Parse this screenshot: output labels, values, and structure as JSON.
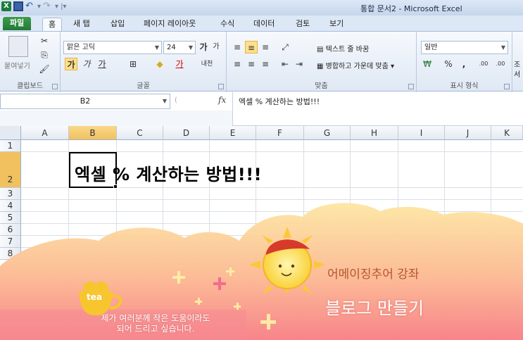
{
  "window": {
    "title": "통합 문서2  -  Microsoft Excel"
  },
  "quick_access": {
    "app_icon": "X",
    "save_icon": "save-icon",
    "undo_icon": "undo-icon",
    "redo_icon": "redo-icon"
  },
  "tabs": [
    "파일",
    "홈",
    "새 탭",
    "삽입",
    "페이지 레이아웃",
    "수식",
    "데이터",
    "검토",
    "보기"
  ],
  "ribbon": {
    "clipboard": {
      "paste_label": "붙여넣기",
      "group_label": "클립보드"
    },
    "font": {
      "font_name": "맑은 고딕",
      "font_size": "24",
      "grow": "가",
      "shrink": "가",
      "bold": "가",
      "italic": "가",
      "underline": "가",
      "font_color": "가",
      "phonetic": "내천",
      "group_label": "글꼴"
    },
    "alignment": {
      "wrap_text": "텍스트 줄 바꿈",
      "merge_center": "병합하고 가운데 맞춤",
      "group_label": "맞춤"
    },
    "number": {
      "format": "일반",
      "percent": "%",
      "comma": ",",
      "inc_decimal": ".00",
      "dec_decimal": ".00",
      "group_label": "표시 형식"
    },
    "styles": {
      "partial_label": "조",
      "partial_label2": "서"
    }
  },
  "formula_bar": {
    "name_box": "B2",
    "fx": "fx",
    "content": "엑셀 % 계산하는 방법!!!"
  },
  "columns": [
    "A",
    "B",
    "C",
    "D",
    "E",
    "F",
    "G",
    "H",
    "I",
    "J",
    "K"
  ],
  "rows": [
    "1",
    "2",
    "3",
    "4",
    "5",
    "6",
    "7",
    "8"
  ],
  "cell_b2_text": "엑셀 % 계산하는 방법!!!",
  "banner": {
    "tea": "tea",
    "caption_line1": "제가 여러분께 작은 도움이라도",
    "caption_line2": "되어 드리고 싶습니다.",
    "headline1": "어메이징추어 강좌",
    "headline2": "블로그 만들기",
    "colors": {
      "cloud_top": "#fde3a0",
      "cloud_bottom": "#f77f86",
      "sun": "#fbd33d",
      "hat": "#d83a2a"
    }
  }
}
